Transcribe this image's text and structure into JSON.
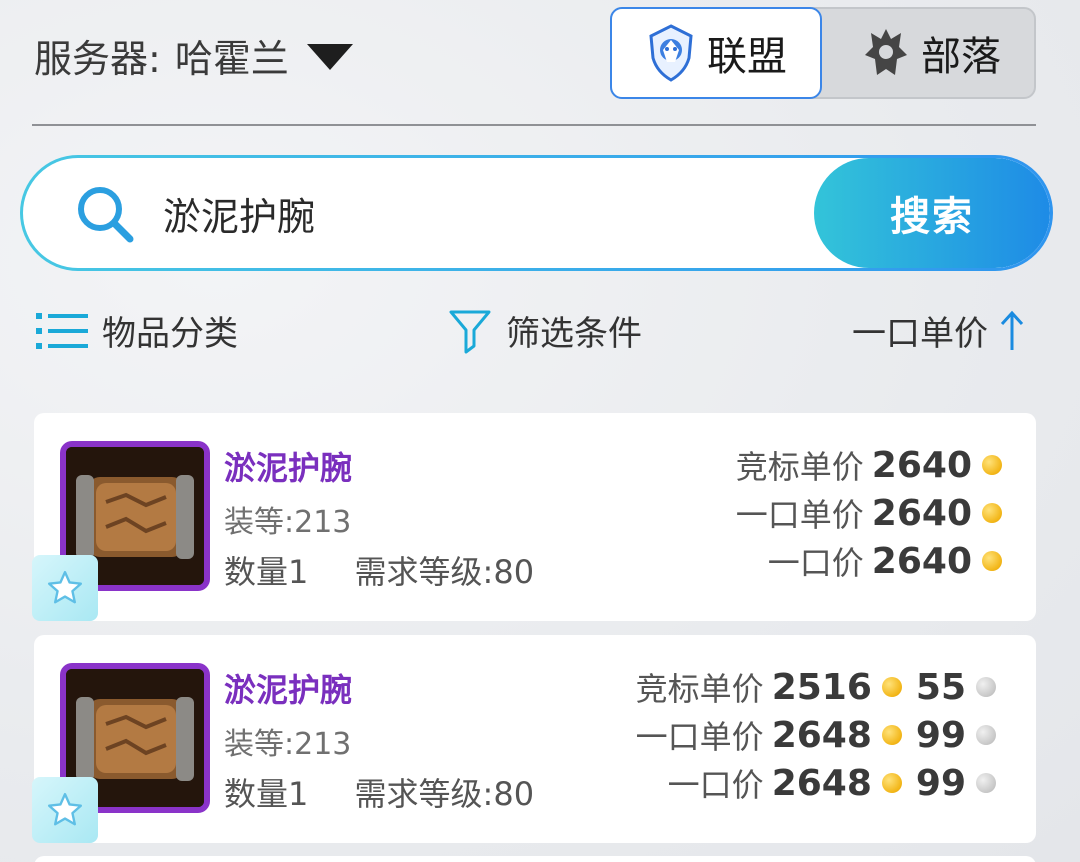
{
  "server": {
    "label": "服务器:",
    "value": "哈霍兰"
  },
  "factions": {
    "alliance": "联盟",
    "horde": "部落",
    "selected": "alliance"
  },
  "search": {
    "value": "淤泥护腕",
    "button": "搜索"
  },
  "filters": {
    "category": "物品分类",
    "filter": "筛选条件",
    "sort": "一口单价"
  },
  "colors": {
    "accent": "#1e8be6",
    "epic": "#7a2fbe"
  },
  "items": [
    {
      "name": "淤泥护腕",
      "ilvl": "装等:213",
      "qty": "数量1",
      "req": "需求等级:80",
      "bid_label": "竞标单价",
      "bid_gold": "2640",
      "unit_label": "一口单价",
      "unit_gold": "2640",
      "buyout_label": "一口价",
      "buyout_gold": "2640"
    },
    {
      "name": "淤泥护腕",
      "ilvl": "装等:213",
      "qty": "数量1",
      "req": "需求等级:80",
      "bid_label": "竞标单价",
      "bid_gold": "2516",
      "bid_silver": "55",
      "unit_label": "一口单价",
      "unit_gold": "2648",
      "unit_silver": "99",
      "buyout_label": "一口价",
      "buyout_gold": "2648",
      "buyout_silver": "99"
    }
  ]
}
